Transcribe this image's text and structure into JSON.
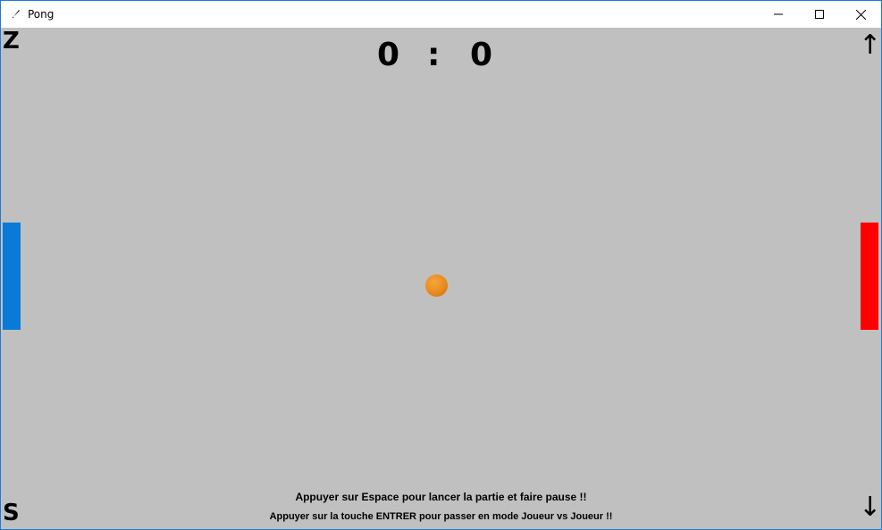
{
  "window": {
    "title": "Pong",
    "icon": "feather-icon"
  },
  "controls": {
    "left_up_key": "Z",
    "left_down_key": "S",
    "right_up_key": "↑",
    "right_down_key": "↓"
  },
  "score": {
    "left": "0",
    "separator": ":",
    "right": "0"
  },
  "messages": {
    "start": "Appuyer sur Espace pour lancer la partie et faire pause !!",
    "mode": "Appuyer sur la touche ENTRER pour passer en mode Joueur vs Joueur !!"
  },
  "colors": {
    "background": "#c0c0c0",
    "left_paddle": "#0a7ad8",
    "right_paddle": "#ff0000",
    "ball": "#ea8a1c"
  }
}
